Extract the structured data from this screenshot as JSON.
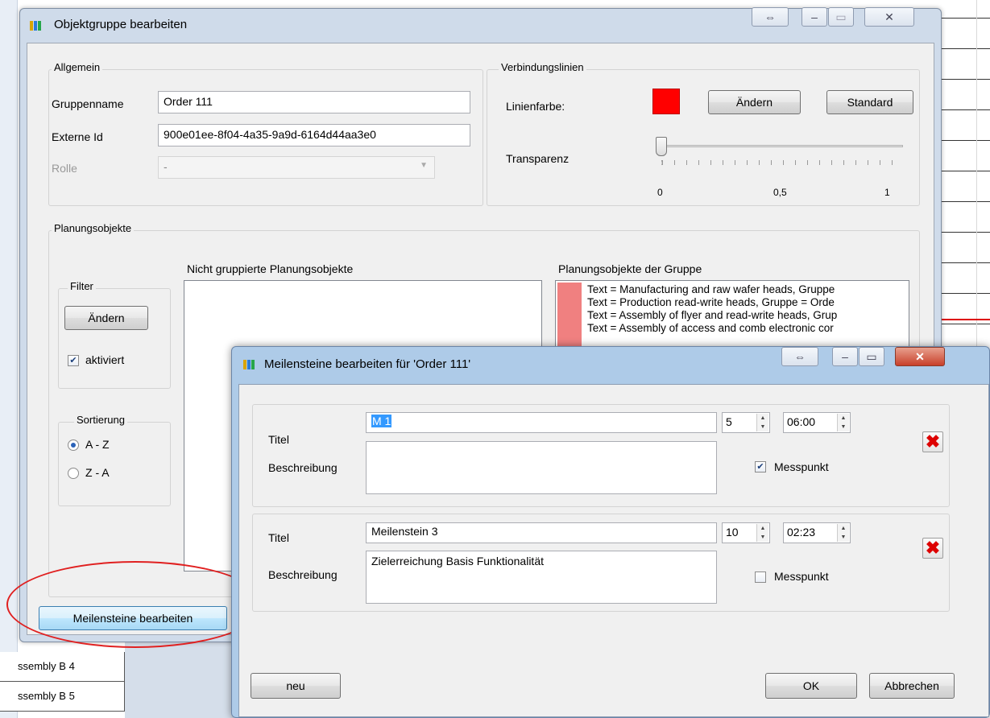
{
  "background": {
    "rows": [
      "ssembly B 4",
      "ssembly B 5"
    ]
  },
  "main_dialog": {
    "title": "Objektgruppe bearbeiten",
    "allgemein": {
      "group_label": "Allgemein",
      "gruppenname_label": "Gruppenname",
      "gruppenname_value": "Order 111",
      "externe_id_label": "Externe Id",
      "externe_id_value": "900e01ee-8f04-4a35-9a9d-6164d44aa3e0",
      "rolle_label": "Rolle",
      "rolle_value": "-"
    },
    "verbindungslinien": {
      "group_label": "Verbindungslinien",
      "linienfarbe_label": "Linienfarbe:",
      "linienfarbe_color": "#ff0000",
      "aendern_label": "Ändern",
      "standard_label": "Standard",
      "transparenz_label": "Transparenz",
      "transparenz_value": 0,
      "tick_0": "0",
      "tick_05": "0,5",
      "tick_1": "1"
    },
    "planungsobjekte": {
      "group_label": "Planungsobjekte",
      "filter_label": "Filter",
      "filter_aendern_label": "Ändern",
      "aktiviert_label": "aktiviert",
      "aktiviert_checked": true,
      "sortierung_label": "Sortierung",
      "sort_az": "A - Z",
      "sort_za": "Z - A",
      "sort_selected": "A - Z",
      "nicht_gruppiert_label": "Nicht gruppierte Planungsobjekte",
      "der_gruppe_label": "Planungsobjekte der Gruppe",
      "group_items": [
        "Text = Manufacturing and raw wafer heads, Gruppe",
        "Text = Production read-write heads, Gruppe = Orde",
        "Text = Assembly of flyer and read-write heads, Grup",
        "Text = Assembly of access and comb electronic cor"
      ],
      "group_item_color": "#f08080"
    },
    "meilensteine_button": "Meilensteine bearbeiten"
  },
  "milestone_dialog": {
    "title": "Meilensteine bearbeiten für 'Order 111'",
    "items": [
      {
        "titel_label": "Titel",
        "titel_value": "M 1",
        "beschreibung_label": "Beschreibung",
        "beschreibung_value": "",
        "day": "5",
        "time": "06:00",
        "messpunkt_label": "Messpunkt",
        "messpunkt_checked": true
      },
      {
        "titel_label": "Titel",
        "titel_value": "Meilenstein 3",
        "beschreibung_label": "Beschreibung",
        "beschreibung_value": "Zielerreichung Basis Funktionalität",
        "day": "10",
        "time": "02:23",
        "messpunkt_label": "Messpunkt",
        "messpunkt_checked": false
      }
    ],
    "neu_label": "neu",
    "ok_label": "OK",
    "abbrechen_label": "Abbrechen"
  }
}
